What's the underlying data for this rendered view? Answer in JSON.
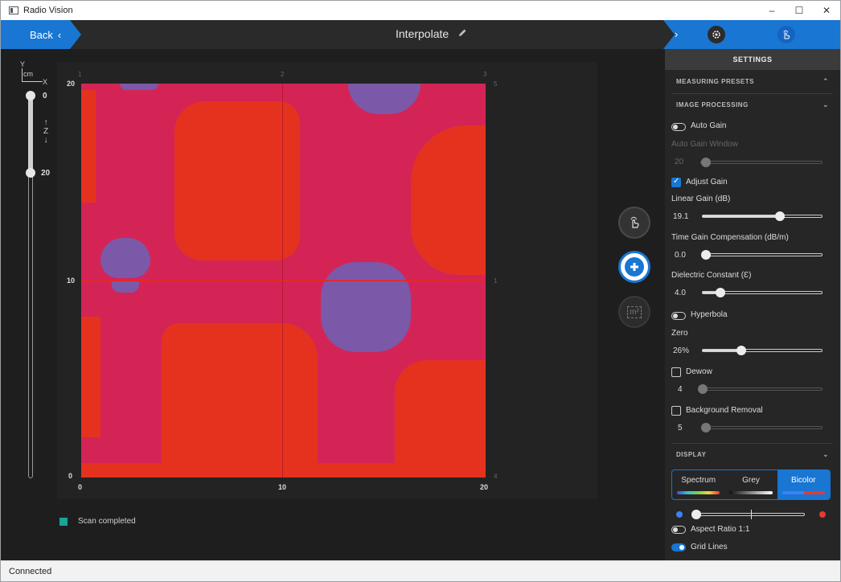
{
  "window": {
    "title": "Radio Vision",
    "controls": [
      "–",
      "☐",
      "✕"
    ]
  },
  "topbar": {
    "back_label": "Back",
    "back_chevron": "‹",
    "title": "Interpolate",
    "right_chevron": "›"
  },
  "depth": {
    "axis_y": "Y",
    "axis_unit": "cm",
    "axis_x": "X",
    "z_label": "Z",
    "top_value": "0",
    "bottom_value": "20"
  },
  "plot": {
    "x_ticks": [
      "0",
      "10",
      "20"
    ],
    "y_ticks": [
      "20",
      "10",
      "0"
    ],
    "grid_top_labels": [
      "1",
      "2",
      "3"
    ],
    "grid_right_labels": [
      "5",
      "1",
      "4"
    ]
  },
  "tools": {
    "touch_icon": "hand-touch-icon",
    "add_icon": "plus-icon",
    "area_label": "m²"
  },
  "status": {
    "scan_text": "Scan completed",
    "connection": "Connected"
  },
  "settings": {
    "header": "SETTINGS",
    "measuring_presets": "MEASURING PRESETS",
    "image_processing": "IMAGE PROCESSING",
    "auto_gain": {
      "label": "Auto Gain",
      "on": false
    },
    "auto_gain_window": {
      "label": "Auto Gain Window",
      "value": "20"
    },
    "adjust_gain": {
      "label": "Adjust Gain",
      "checked": true
    },
    "linear_gain": {
      "label": "Linear Gain (dB)",
      "value": "19.1"
    },
    "tgc": {
      "label": "Time Gain Compensation (dB/m)",
      "value": "0.0"
    },
    "dielectric": {
      "label": "Dielectric Constant (Ɛ)",
      "value": "4.0"
    },
    "hyperbola": {
      "label": "Hyperbola",
      "on": false
    },
    "zero": {
      "label": "Zero",
      "value": "26%"
    },
    "dewow": {
      "label": "Dewow",
      "checked": false,
      "value": "4"
    },
    "background_removal": {
      "label": "Background Removal",
      "checked": false,
      "value": "5"
    },
    "display": "DISPLAY",
    "color_modes": [
      "Spectrum",
      "Grey",
      "Bicolor"
    ],
    "active_mode": "Bicolor",
    "aspect_ratio": {
      "label": "Aspect Ratio 1:1",
      "on": false
    },
    "grid_lines": {
      "label": "Grid Lines",
      "on": true
    }
  },
  "colors": {
    "accent": "#1976d2",
    "scan_complete": "#1aa39a",
    "bicolor_low": "#3b82f6",
    "bicolor_high": "#e53935"
  }
}
